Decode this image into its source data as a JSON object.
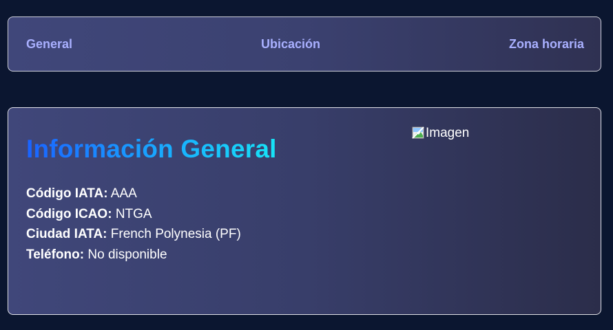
{
  "tabs": [
    {
      "label": "General"
    },
    {
      "label": "Ubicación"
    },
    {
      "label": "Zona horaria"
    }
  ],
  "section": {
    "title": "Información General",
    "image_alt": "Imagen",
    "fields": [
      {
        "label": "Código IATA:",
        "value": "AAA"
      },
      {
        "label": "Código ICAO:",
        "value": "NTGA"
      },
      {
        "label": "Ciudad IATA:",
        "value": "French Polynesia (PF)"
      },
      {
        "label": "Teléfono:",
        "value": "No disponible"
      }
    ]
  },
  "colors": {
    "page_bg": "#0b1630",
    "tab_text": "#a9b0ff",
    "title_gradient_start": "#1a63ff",
    "title_gradient_end": "#17e4f7"
  }
}
